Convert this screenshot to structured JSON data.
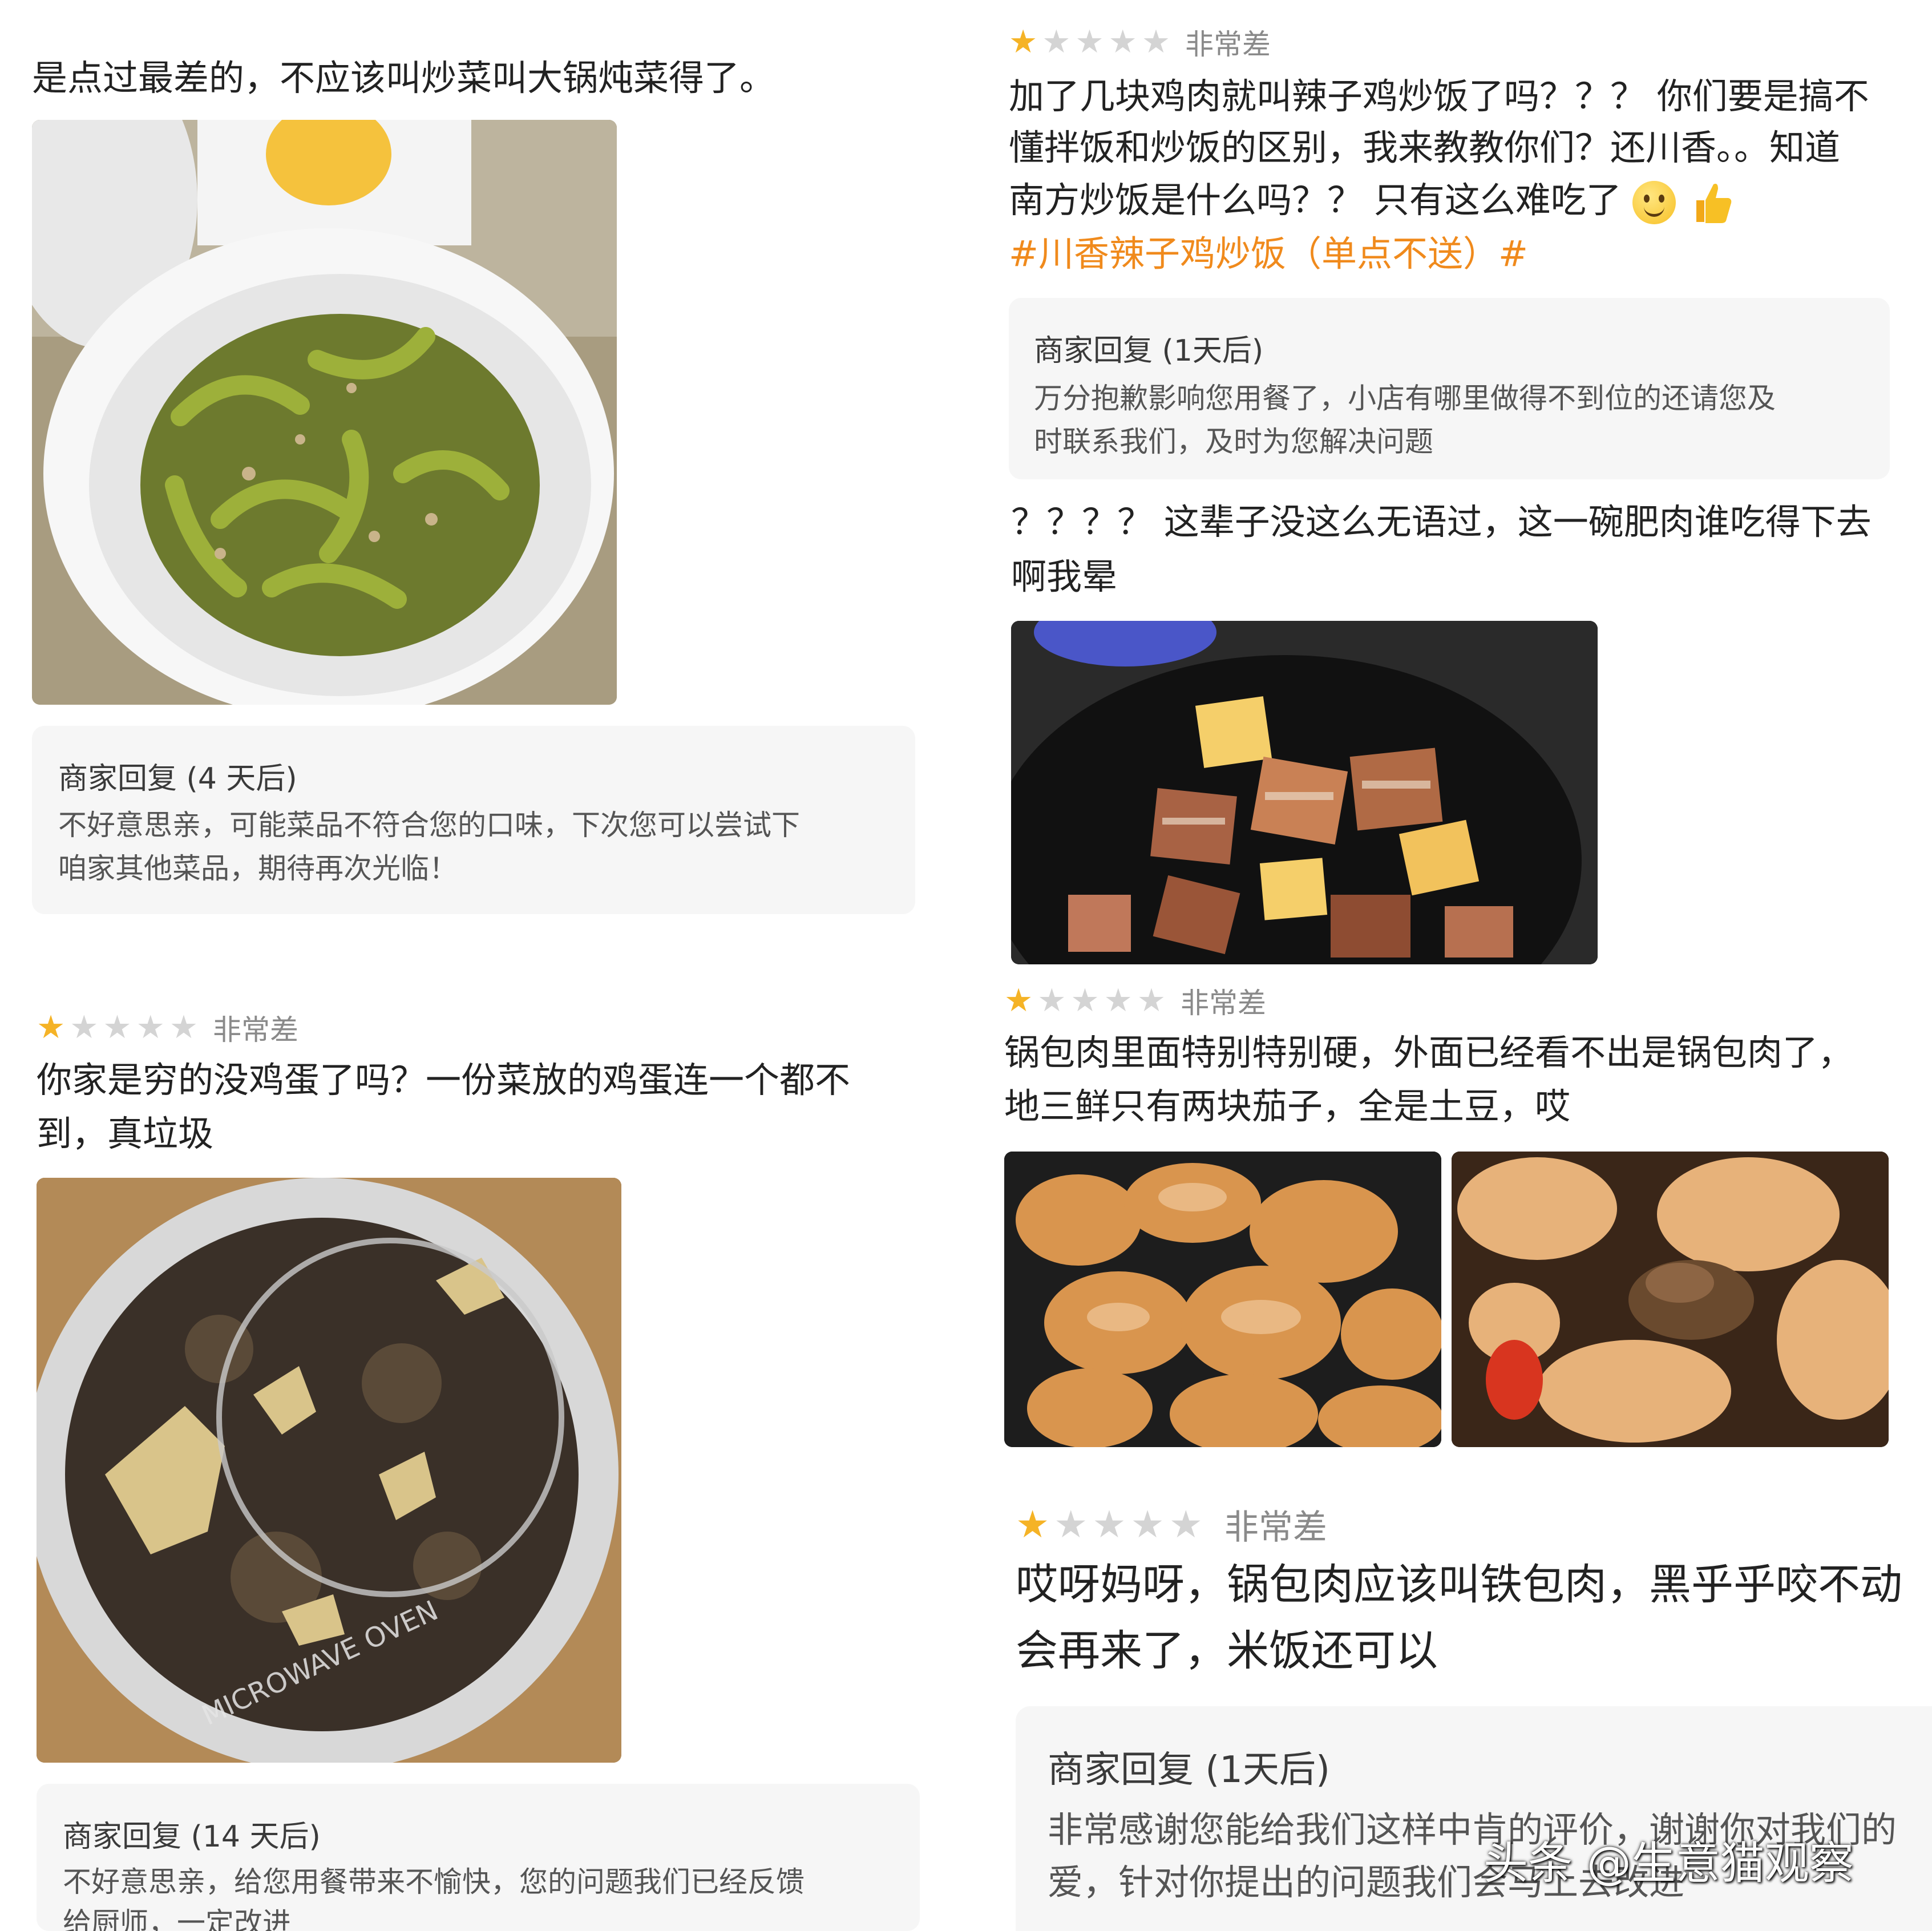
{
  "left_column": {
    "review_a": {
      "text_line": "是点过最差的，不应该叫炒菜叫大锅炖菜得了。",
      "reply": {
        "title": "商家回复 (4 天后)",
        "lines": [
          "不好意思亲，可能菜品不符合您的口味，下次您可以尝试下",
          "咱家其他菜品，期待再次光临！"
        ]
      }
    },
    "review_b": {
      "rating_label": "非常差",
      "rating_value": 1,
      "lines": [
        "你家是穷的没鸡蛋了吗？一份菜放的鸡蛋连一个都不",
        "到，真垃圾"
      ],
      "photo_text": "MICROWAVE OVEN",
      "reply": {
        "title": "商家回复 (14 天后)",
        "lines": [
          "不好意思亲，给您用餐带来不愉快，您的问题我们已经反馈",
          "给厨师，一定改进"
        ]
      }
    }
  },
  "right_column": {
    "review_c": {
      "rating_label": "非常差",
      "rating_value": 1,
      "lines": [
        "加了几块鸡肉就叫辣子鸡炒饭了吗？？？ 你们要是搞不",
        "懂拌饭和炒饭的区别，我来教教你们？还川香。。知道",
        "南方炒饭是什么吗？？ 只有这么难吃了"
      ],
      "tag": "#川香辣子鸡炒饭（单点不送）#",
      "reply": {
        "title": "商家回复 (1天后)",
        "lines": [
          "万分抱歉影响您用餐了，小店有哪里做得不到位的还请您及",
          "时联系我们，及时为您解决问题"
        ]
      }
    },
    "review_d": {
      "lines": [
        "？？？？ 这辈子没这么无语过，这一碗肥肉谁吃得下去",
        "啊我晕"
      ]
    },
    "review_e": {
      "rating_label": "非常差",
      "rating_value": 1,
      "lines": [
        "锅包肉里面特别特别硬，外面已经看不出是锅包肉了，",
        "地三鲜只有两块茄子，全是土豆，哎"
      ]
    },
    "review_f": {
      "rating_label": "非常差",
      "rating_value": 1,
      "lines": [
        "哎呀妈呀，锅包肉应该叫铁包肉，黑乎乎咬不动",
        "会再来了，米饭还可以"
      ],
      "reply": {
        "title": "商家回复 (1天后)",
        "lines": [
          "非常感谢您能给我们这样中肯的评价，谢谢你对我们的",
          "爱，针对你提出的问题我们会马上去改进"
        ]
      }
    }
  },
  "watermark": "头条 @生意猫观察",
  "colors": {
    "star_on": "#f5b326",
    "star_off": "#d4d4d4",
    "tag": "#f08a1c",
    "reply_bg": "#f6f6f6"
  }
}
